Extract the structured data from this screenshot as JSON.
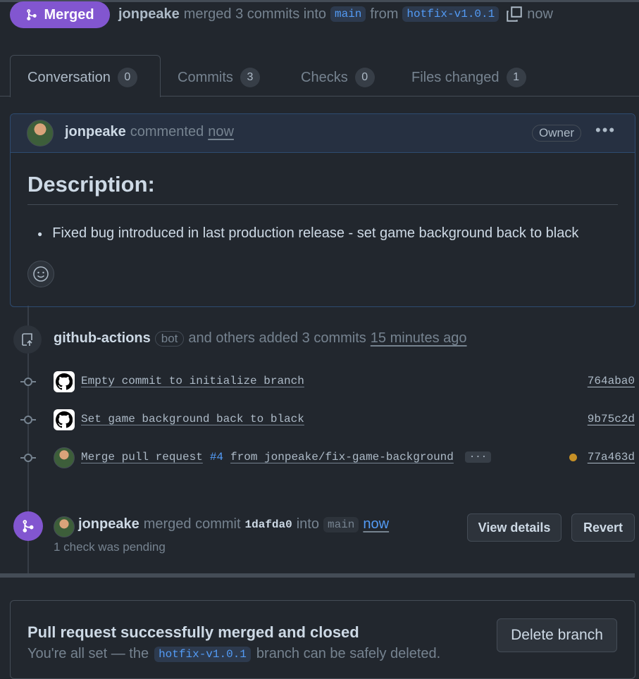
{
  "header": {
    "status_label": "Merged",
    "author": "jonpeake",
    "action_text": "merged 3 commits into",
    "base_branch": "main",
    "from_text": "from",
    "head_branch": "hotfix-v1.0.1",
    "time": "now"
  },
  "tabs": [
    {
      "label": "Conversation",
      "count": "0"
    },
    {
      "label": "Commits",
      "count": "3"
    },
    {
      "label": "Checks",
      "count": "0"
    },
    {
      "label": "Files changed",
      "count": "1"
    }
  ],
  "comment": {
    "author": "jonpeake",
    "action": "commented",
    "time": "now",
    "role_badge": "Owner",
    "heading": "Description:",
    "bullet": "Fixed bug introduced in last production release - set game background back to black"
  },
  "commits_event": {
    "author": "github-actions",
    "badge": "bot",
    "text": "and others added 3 commits",
    "time": "15 minutes ago",
    "commits": [
      {
        "message": "Empty commit to initialize branch",
        "sha": "764aba0"
      },
      {
        "message": "Set game background back to black",
        "sha": "9b75c2d"
      },
      {
        "message_prefix": "Merge pull request",
        "pr_link": "#4",
        "message_suffix": "from jonpeake/fix-game-background",
        "ellipsis": "···",
        "sha": "77a463d"
      }
    ]
  },
  "merge_event": {
    "author": "jonpeake",
    "text": "merged commit",
    "sha": "1dafda0",
    "into_text": "into",
    "branch": "main",
    "time": "now",
    "sub_text": "1 check was pending",
    "view_details_label": "View details",
    "revert_label": "Revert"
  },
  "merge_box": {
    "title": "Pull request successfully merged and closed",
    "text_before": "You're all set — the",
    "branch": "hotfix-v1.0.1",
    "text_after": "branch can be safely deleted.",
    "delete_label": "Delete branch"
  },
  "colors": {
    "merged": "#8256d0",
    "link": "#539bf5",
    "pending": "#c69026",
    "bg": "#22272e"
  }
}
